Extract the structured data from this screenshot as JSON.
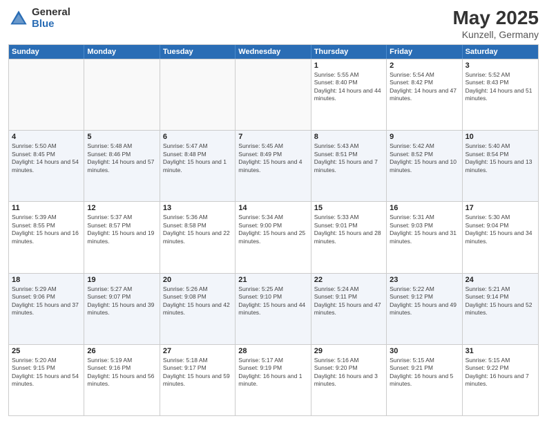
{
  "logo": {
    "general": "General",
    "blue": "Blue"
  },
  "title": {
    "month": "May 2025",
    "location": "Kunzell, Germany"
  },
  "header_days": [
    "Sunday",
    "Monday",
    "Tuesday",
    "Wednesday",
    "Thursday",
    "Friday",
    "Saturday"
  ],
  "weeks": [
    [
      {
        "day": "",
        "sunrise": "",
        "sunset": "",
        "daylight": "",
        "empty": true
      },
      {
        "day": "",
        "sunrise": "",
        "sunset": "",
        "daylight": "",
        "empty": true
      },
      {
        "day": "",
        "sunrise": "",
        "sunset": "",
        "daylight": "",
        "empty": true
      },
      {
        "day": "",
        "sunrise": "",
        "sunset": "",
        "daylight": "",
        "empty": true
      },
      {
        "day": "1",
        "sunrise": "Sunrise: 5:55 AM",
        "sunset": "Sunset: 8:40 PM",
        "daylight": "Daylight: 14 hours and 44 minutes.",
        "empty": false
      },
      {
        "day": "2",
        "sunrise": "Sunrise: 5:54 AM",
        "sunset": "Sunset: 8:42 PM",
        "daylight": "Daylight: 14 hours and 47 minutes.",
        "empty": false
      },
      {
        "day": "3",
        "sunrise": "Sunrise: 5:52 AM",
        "sunset": "Sunset: 8:43 PM",
        "daylight": "Daylight: 14 hours and 51 minutes.",
        "empty": false
      }
    ],
    [
      {
        "day": "4",
        "sunrise": "Sunrise: 5:50 AM",
        "sunset": "Sunset: 8:45 PM",
        "daylight": "Daylight: 14 hours and 54 minutes.",
        "empty": false
      },
      {
        "day": "5",
        "sunrise": "Sunrise: 5:48 AM",
        "sunset": "Sunset: 8:46 PM",
        "daylight": "Daylight: 14 hours and 57 minutes.",
        "empty": false
      },
      {
        "day": "6",
        "sunrise": "Sunrise: 5:47 AM",
        "sunset": "Sunset: 8:48 PM",
        "daylight": "Daylight: 15 hours and 1 minute.",
        "empty": false
      },
      {
        "day": "7",
        "sunrise": "Sunrise: 5:45 AM",
        "sunset": "Sunset: 8:49 PM",
        "daylight": "Daylight: 15 hours and 4 minutes.",
        "empty": false
      },
      {
        "day": "8",
        "sunrise": "Sunrise: 5:43 AM",
        "sunset": "Sunset: 8:51 PM",
        "daylight": "Daylight: 15 hours and 7 minutes.",
        "empty": false
      },
      {
        "day": "9",
        "sunrise": "Sunrise: 5:42 AM",
        "sunset": "Sunset: 8:52 PM",
        "daylight": "Daylight: 15 hours and 10 minutes.",
        "empty": false
      },
      {
        "day": "10",
        "sunrise": "Sunrise: 5:40 AM",
        "sunset": "Sunset: 8:54 PM",
        "daylight": "Daylight: 15 hours and 13 minutes.",
        "empty": false
      }
    ],
    [
      {
        "day": "11",
        "sunrise": "Sunrise: 5:39 AM",
        "sunset": "Sunset: 8:55 PM",
        "daylight": "Daylight: 15 hours and 16 minutes.",
        "empty": false
      },
      {
        "day": "12",
        "sunrise": "Sunrise: 5:37 AM",
        "sunset": "Sunset: 8:57 PM",
        "daylight": "Daylight: 15 hours and 19 minutes.",
        "empty": false
      },
      {
        "day": "13",
        "sunrise": "Sunrise: 5:36 AM",
        "sunset": "Sunset: 8:58 PM",
        "daylight": "Daylight: 15 hours and 22 minutes.",
        "empty": false
      },
      {
        "day": "14",
        "sunrise": "Sunrise: 5:34 AM",
        "sunset": "Sunset: 9:00 PM",
        "daylight": "Daylight: 15 hours and 25 minutes.",
        "empty": false
      },
      {
        "day": "15",
        "sunrise": "Sunrise: 5:33 AM",
        "sunset": "Sunset: 9:01 PM",
        "daylight": "Daylight: 15 hours and 28 minutes.",
        "empty": false
      },
      {
        "day": "16",
        "sunrise": "Sunrise: 5:31 AM",
        "sunset": "Sunset: 9:03 PM",
        "daylight": "Daylight: 15 hours and 31 minutes.",
        "empty": false
      },
      {
        "day": "17",
        "sunrise": "Sunrise: 5:30 AM",
        "sunset": "Sunset: 9:04 PM",
        "daylight": "Daylight: 15 hours and 34 minutes.",
        "empty": false
      }
    ],
    [
      {
        "day": "18",
        "sunrise": "Sunrise: 5:29 AM",
        "sunset": "Sunset: 9:06 PM",
        "daylight": "Daylight: 15 hours and 37 minutes.",
        "empty": false
      },
      {
        "day": "19",
        "sunrise": "Sunrise: 5:27 AM",
        "sunset": "Sunset: 9:07 PM",
        "daylight": "Daylight: 15 hours and 39 minutes.",
        "empty": false
      },
      {
        "day": "20",
        "sunrise": "Sunrise: 5:26 AM",
        "sunset": "Sunset: 9:08 PM",
        "daylight": "Daylight: 15 hours and 42 minutes.",
        "empty": false
      },
      {
        "day": "21",
        "sunrise": "Sunrise: 5:25 AM",
        "sunset": "Sunset: 9:10 PM",
        "daylight": "Daylight: 15 hours and 44 minutes.",
        "empty": false
      },
      {
        "day": "22",
        "sunrise": "Sunrise: 5:24 AM",
        "sunset": "Sunset: 9:11 PM",
        "daylight": "Daylight: 15 hours and 47 minutes.",
        "empty": false
      },
      {
        "day": "23",
        "sunrise": "Sunrise: 5:22 AM",
        "sunset": "Sunset: 9:12 PM",
        "daylight": "Daylight: 15 hours and 49 minutes.",
        "empty": false
      },
      {
        "day": "24",
        "sunrise": "Sunrise: 5:21 AM",
        "sunset": "Sunset: 9:14 PM",
        "daylight": "Daylight: 15 hours and 52 minutes.",
        "empty": false
      }
    ],
    [
      {
        "day": "25",
        "sunrise": "Sunrise: 5:20 AM",
        "sunset": "Sunset: 9:15 PM",
        "daylight": "Daylight: 15 hours and 54 minutes.",
        "empty": false
      },
      {
        "day": "26",
        "sunrise": "Sunrise: 5:19 AM",
        "sunset": "Sunset: 9:16 PM",
        "daylight": "Daylight: 15 hours and 56 minutes.",
        "empty": false
      },
      {
        "day": "27",
        "sunrise": "Sunrise: 5:18 AM",
        "sunset": "Sunset: 9:17 PM",
        "daylight": "Daylight: 15 hours and 59 minutes.",
        "empty": false
      },
      {
        "day": "28",
        "sunrise": "Sunrise: 5:17 AM",
        "sunset": "Sunset: 9:19 PM",
        "daylight": "Daylight: 16 hours and 1 minute.",
        "empty": false
      },
      {
        "day": "29",
        "sunrise": "Sunrise: 5:16 AM",
        "sunset": "Sunset: 9:20 PM",
        "daylight": "Daylight: 16 hours and 3 minutes.",
        "empty": false
      },
      {
        "day": "30",
        "sunrise": "Sunrise: 5:15 AM",
        "sunset": "Sunset: 9:21 PM",
        "daylight": "Daylight: 16 hours and 5 minutes.",
        "empty": false
      },
      {
        "day": "31",
        "sunrise": "Sunrise: 5:15 AM",
        "sunset": "Sunset: 9:22 PM",
        "daylight": "Daylight: 16 hours and 7 minutes.",
        "empty": false
      }
    ]
  ]
}
